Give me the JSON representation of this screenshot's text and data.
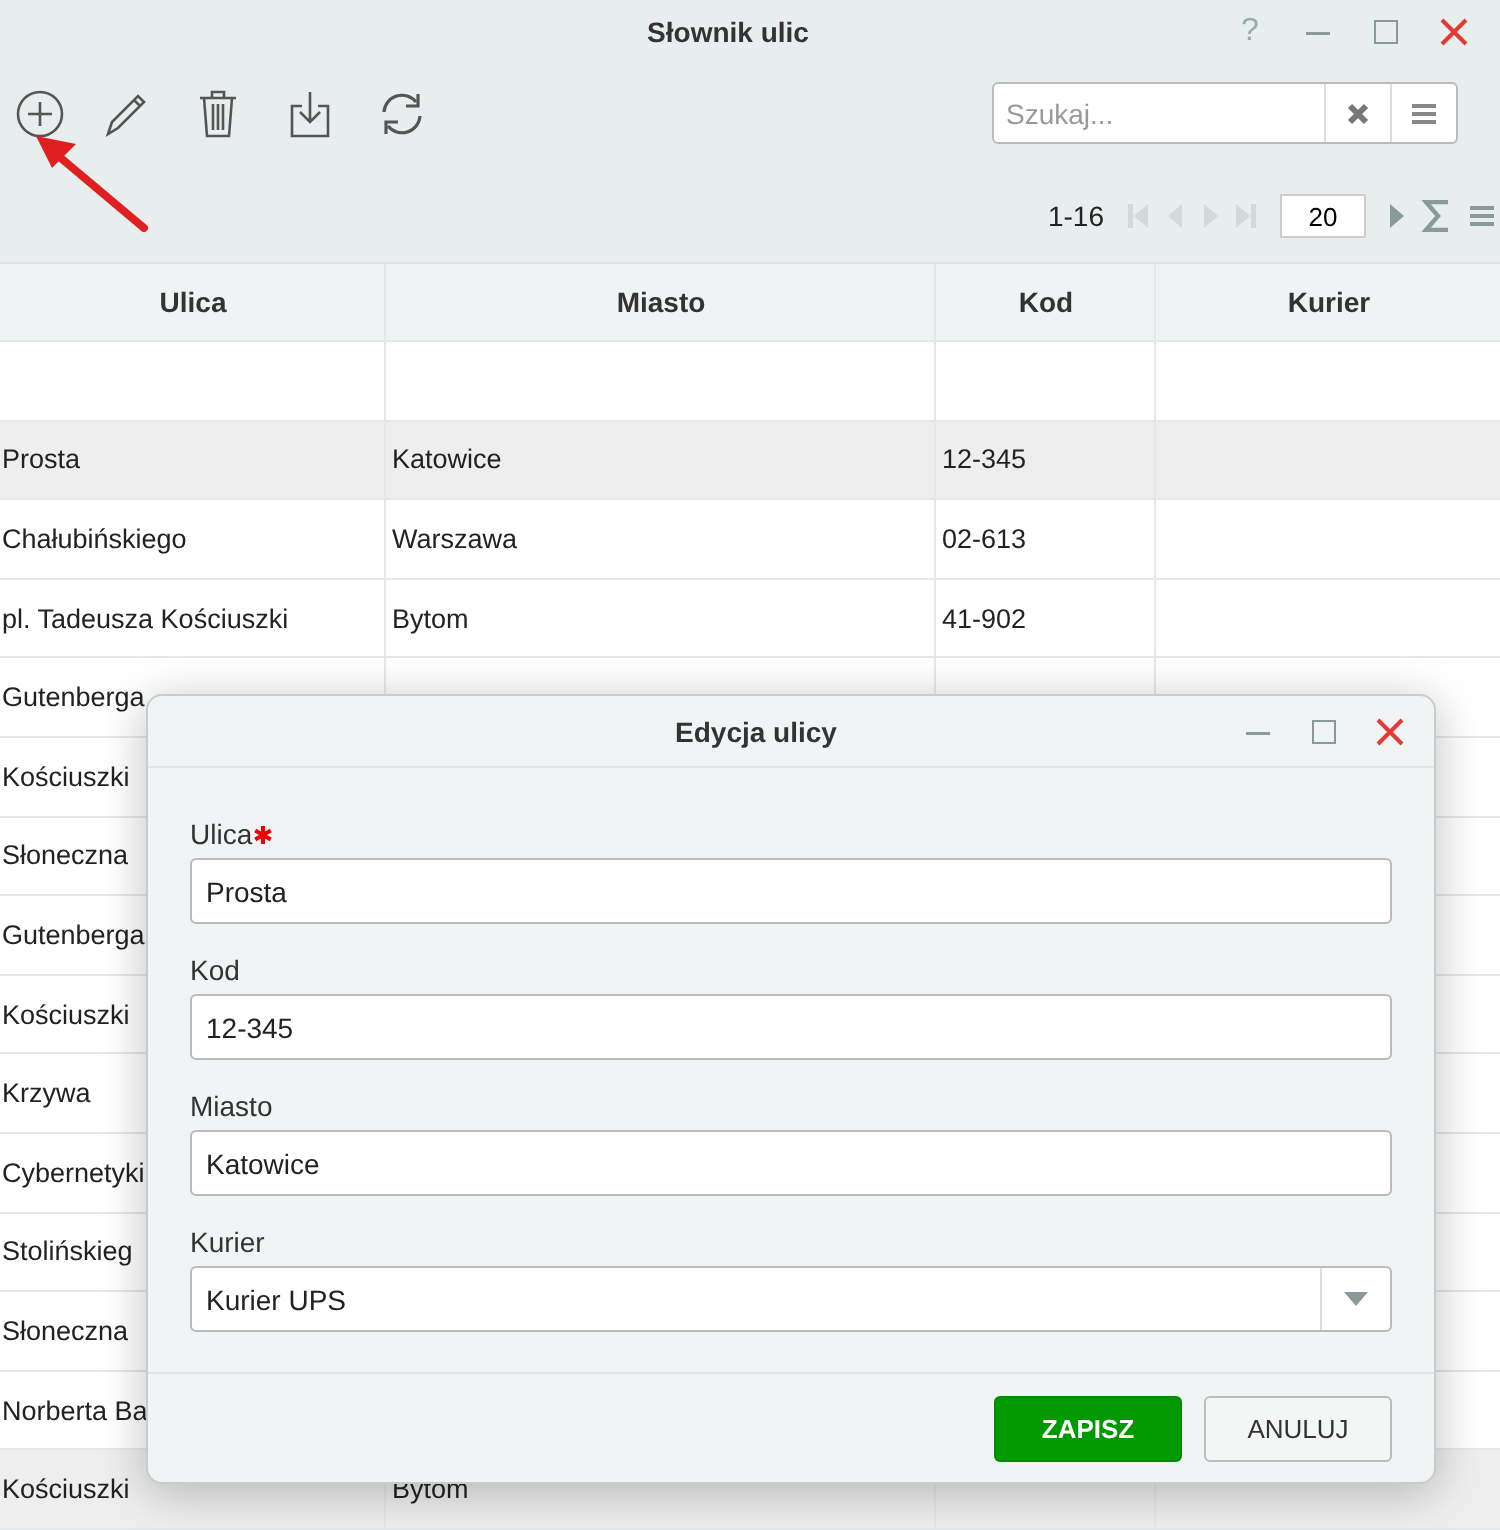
{
  "window": {
    "title": "Słownik ulic",
    "help": "?"
  },
  "search": {
    "placeholder": "Szukaj..."
  },
  "pagination": {
    "range": "1-16",
    "page_size": "20"
  },
  "table": {
    "columns": [
      "Ulica",
      "Miasto",
      "Kod",
      "Kurier"
    ],
    "rows": [
      {
        "ulica": "Prosta",
        "miasto": "Katowice",
        "kod": "12-345",
        "selected": true
      },
      {
        "ulica": "Chałubińskiego",
        "miasto": "Warszawa",
        "kod": "02-613",
        "selected": false
      },
      {
        "ulica": "pl. Tadeusza Kościuszki",
        "miasto": "Bytom",
        "kod": "41-902",
        "selected": false
      },
      {
        "ulica": "Gutenberga",
        "selected": false
      },
      {
        "ulica": "Kościuszki",
        "selected": false
      },
      {
        "ulica": "Słoneczna",
        "selected": false
      },
      {
        "ulica": "Gutenberga",
        "selected": false
      },
      {
        "ulica": "Kościuszki",
        "selected": false
      },
      {
        "ulica": "Krzywa",
        "selected": false
      },
      {
        "ulica": "Cybernetyki",
        "selected": false
      },
      {
        "ulica": "Stolińskieg",
        "selected": false
      },
      {
        "ulica": "Słoneczna",
        "selected": false
      },
      {
        "ulica": "Norberta Ba",
        "selected": false
      },
      {
        "ulica": "Kościuszki",
        "miasto": "Bytom",
        "selected": true
      }
    ]
  },
  "dialog": {
    "title": "Edycja ulicy",
    "fields": [
      {
        "label": "Ulica",
        "required": true,
        "value": "Prosta",
        "kind": "text"
      },
      {
        "label": "Kod",
        "required": false,
        "value": "12-345",
        "kind": "text"
      },
      {
        "label": "Miasto",
        "required": false,
        "value": "Katowice",
        "kind": "text"
      },
      {
        "label": "Kurier",
        "required": false,
        "value": "Kurier UPS",
        "kind": "select"
      }
    ],
    "buttons": [
      {
        "label": "ZAPISZ",
        "kind": "primary"
      },
      {
        "label": "ANULUJ",
        "kind": "secondary"
      }
    ]
  }
}
